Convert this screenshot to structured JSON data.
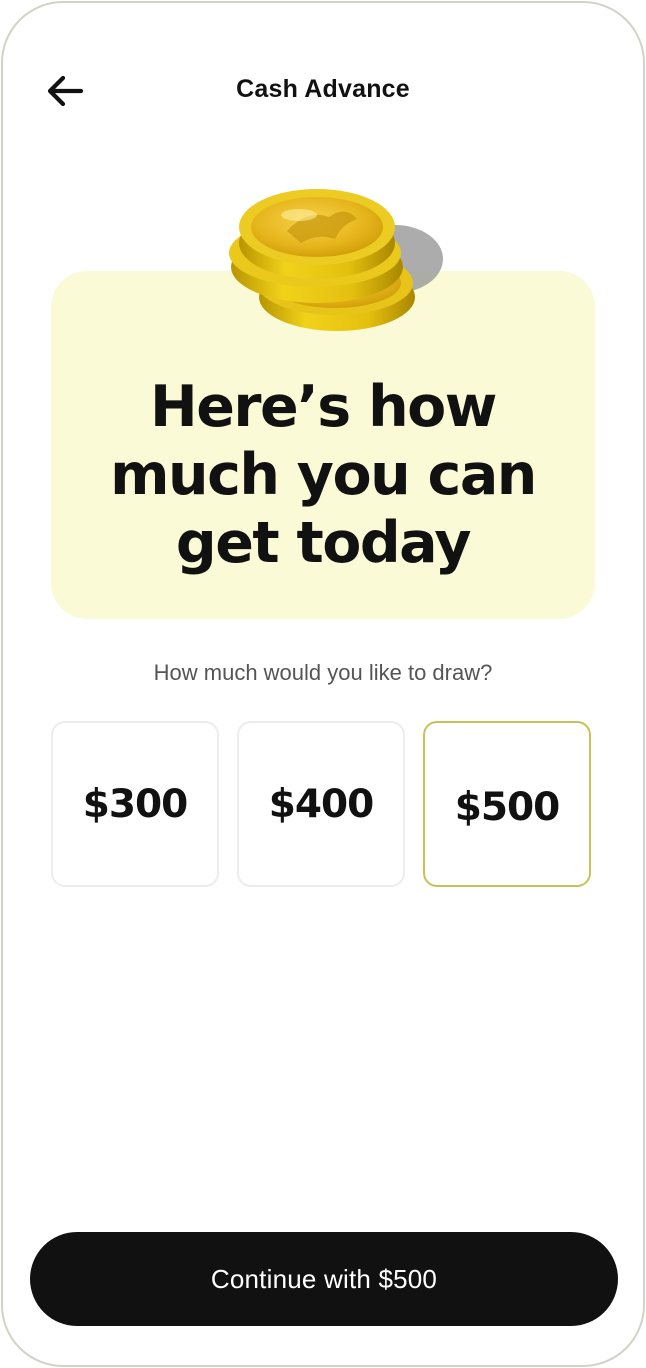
{
  "header": {
    "title": "Cash Advance",
    "back_icon": "arrow-left-icon"
  },
  "hero": {
    "illustration": "gold-coins-icon",
    "background_color": "#fafad6",
    "title_line1": "Here’s how",
    "title_line2": "much you can",
    "title_line3": "get today"
  },
  "selection": {
    "prompt": "How much would you like to draw?",
    "options": [
      {
        "label": "$300",
        "selected": false
      },
      {
        "label": "$400",
        "selected": false
      },
      {
        "label": "$500",
        "selected": true
      }
    ],
    "selected_border_color": "#c5c25a"
  },
  "footer": {
    "continue_label": "Continue with $500",
    "button_color": "#111111"
  }
}
